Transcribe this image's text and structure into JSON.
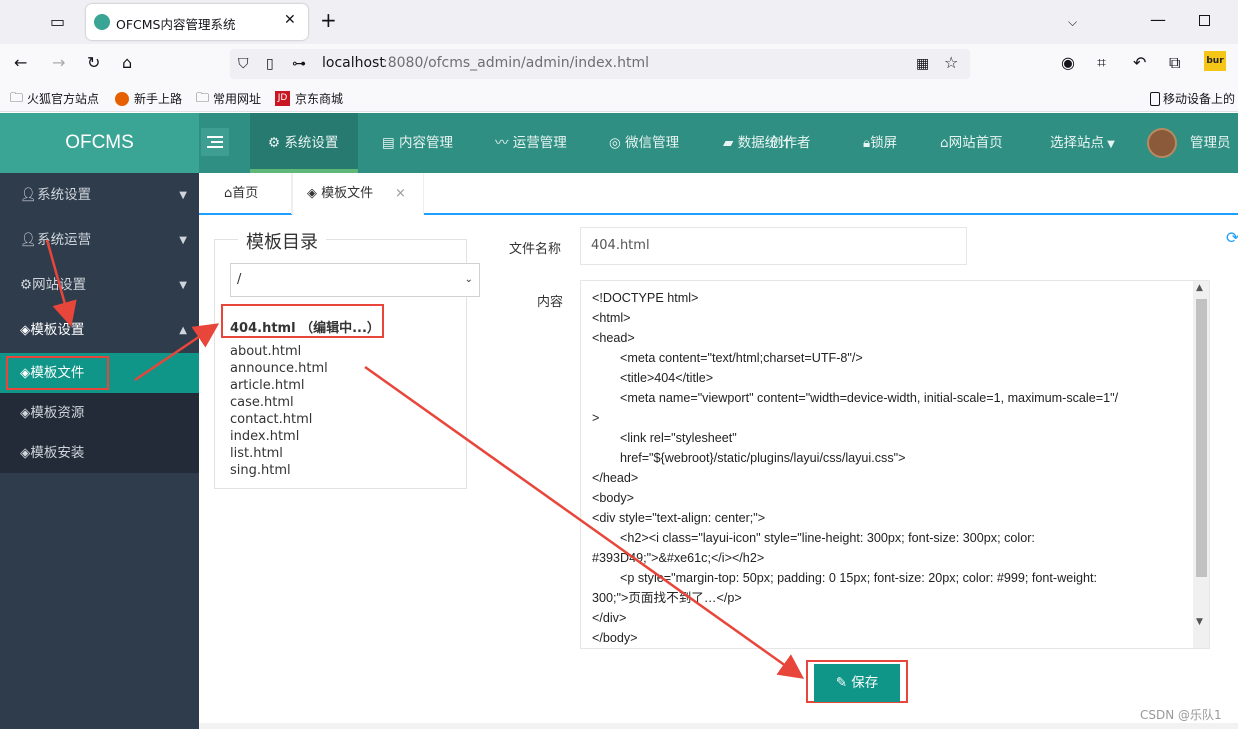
{
  "browser": {
    "tab_title": "OFCMS内容管理系统",
    "url_host": "localhost",
    "url_rest": ":8080/ofcms_admin/admin/index.html",
    "bookmarks": [
      "火狐官方站点",
      "新手上路",
      "常用网址",
      "京东商城"
    ],
    "mobile_bookmark": "移动设备上的",
    "ext_label": "bur"
  },
  "app": {
    "logo": "OFCMS",
    "nav": [
      "系统设置",
      "内容管理",
      "运营管理",
      "微信管理",
      "数据统计",
      "创作者",
      "锁屏",
      "网站首页",
      "选择站点"
    ],
    "user": "管理员"
  },
  "sidebar": {
    "items": [
      "系统设置",
      "系统运营",
      "网站设置",
      "模板设置"
    ],
    "sub": [
      "模板文件",
      "模板资源",
      "模板安装"
    ]
  },
  "tabs": {
    "home": "首页",
    "current": "模板文件",
    "close": "×"
  },
  "dir": {
    "title": "模板目录",
    "select": "/",
    "editing": "404.html （编辑中...）",
    "files": [
      "about.html",
      "announce.html",
      "article.html",
      "case.html",
      "contact.html",
      "index.html",
      "list.html",
      "sing.html"
    ]
  },
  "form": {
    "name_label": "文件名称",
    "name_value": "404.html",
    "content_label": "内容",
    "content_lines": [
      "<!DOCTYPE html>",
      "<html>",
      "<head>",
      "        <meta content=\"text/html;charset=UTF-8\"/>",
      "        <title>404</title>",
      "        <meta name=\"viewport\" content=\"width=device-width, initial-scale=1, maximum-scale=1\"/",
      ">",
      "        <link rel=\"stylesheet\"",
      "        href=\"${webroot}/static/plugins/layui/css/layui.css\">",
      "</head>",
      "<body>",
      "<div style=\"text-align: center;\">",
      "        <h2><i class=\"layui-icon\" style=\"line-height: 300px; font-size: 300px; color:",
      "#393D49;\">&#xe61c;</i></h2>",
      "        <p style=\"margin-top: 50px; padding: 0 15px; font-size: 20px; color: #999; font-weight:",
      "300;\">页面找不到了…</p>",
      "</div>",
      "</body>"
    ],
    "save": "保存"
  },
  "watermark": "CSDN @乐队1",
  "colors": {
    "header": "#2f8f83",
    "sidebar": "#2f3c4c",
    "active": "#0f9688",
    "annotation": "#e8463a"
  }
}
